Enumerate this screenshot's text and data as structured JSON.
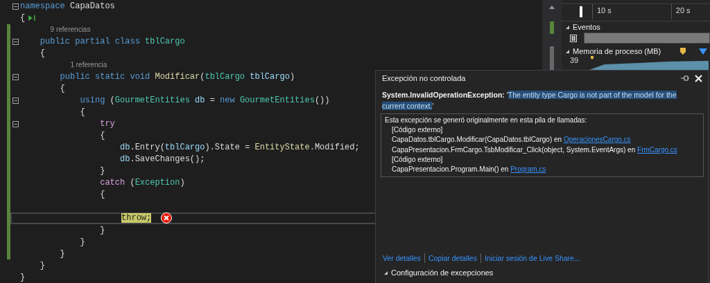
{
  "editor": {
    "lines": [
      {
        "kind": "code",
        "foldable": true,
        "changed": false,
        "tokens": [
          {
            "text": "namespace",
            "kind": "keyword"
          },
          {
            "text": " CapaDatos",
            "kind": "plain"
          }
        ]
      },
      {
        "kind": "code",
        "foldable": false,
        "changed": false,
        "run_marker": true,
        "tokens": [
          {
            "text": "{",
            "kind": "plain"
          }
        ]
      },
      {
        "kind": "lens",
        "changed": true,
        "text": "        9 referencias"
      },
      {
        "kind": "code",
        "foldable": true,
        "changed": true,
        "tokens": [
          {
            "text": "    public partial class",
            "kind": "keyword"
          },
          {
            "text": " tblCargo",
            "kind": "type"
          }
        ]
      },
      {
        "kind": "code",
        "foldable": false,
        "changed": true,
        "tokens": [
          {
            "text": "    {",
            "kind": "plain"
          }
        ]
      },
      {
        "kind": "lens",
        "changed": true,
        "text": "            1 referencia"
      },
      {
        "kind": "code",
        "foldable": true,
        "changed": true,
        "tokens": [
          {
            "text": "        public static void",
            "kind": "keyword"
          },
          {
            "text": " Modificar",
            "kind": "method"
          },
          {
            "text": "(",
            "kind": "plain"
          },
          {
            "text": "tblCargo",
            "kind": "type"
          },
          {
            "text": " tblCargo",
            "kind": "variable"
          },
          {
            "text": ")",
            "kind": "plain"
          }
        ]
      },
      {
        "kind": "code",
        "foldable": false,
        "changed": true,
        "tokens": [
          {
            "text": "        {",
            "kind": "plain"
          }
        ]
      },
      {
        "kind": "code",
        "foldable": true,
        "changed": true,
        "tokens": [
          {
            "text": "            using",
            "kind": "keyword"
          },
          {
            "text": " (",
            "kind": "plain"
          },
          {
            "text": "GourmetEntities",
            "kind": "type"
          },
          {
            "text": " db",
            "kind": "variable"
          },
          {
            "text": " = ",
            "kind": "plain"
          },
          {
            "text": "new",
            "kind": "keyword"
          },
          {
            "text": " GourmetEntities",
            "kind": "type"
          },
          {
            "text": "())",
            "kind": "plain"
          }
        ]
      },
      {
        "kind": "code",
        "foldable": false,
        "changed": true,
        "tokens": [
          {
            "text": "            {",
            "kind": "plain"
          }
        ]
      },
      {
        "kind": "code",
        "foldable": true,
        "changed": true,
        "tokens": [
          {
            "text": "                try",
            "kind": "control"
          }
        ]
      },
      {
        "kind": "code",
        "foldable": false,
        "changed": true,
        "tokens": [
          {
            "text": "                {",
            "kind": "plain"
          }
        ]
      },
      {
        "kind": "code",
        "foldable": false,
        "changed": true,
        "tokens": [
          {
            "text": "                    db",
            "kind": "variable"
          },
          {
            "text": ".Entry(",
            "kind": "plain"
          },
          {
            "text": "tblCargo",
            "kind": "variable"
          },
          {
            "text": ").State = ",
            "kind": "plain"
          },
          {
            "text": "EntityState",
            "kind": "method"
          },
          {
            "text": ".Modified;",
            "kind": "plain"
          }
        ]
      },
      {
        "kind": "code",
        "foldable": false,
        "changed": true,
        "tokens": [
          {
            "text": "                    db",
            "kind": "variable"
          },
          {
            "text": ".SaveChanges();",
            "kind": "plain"
          }
        ]
      },
      {
        "kind": "code",
        "foldable": false,
        "changed": true,
        "tokens": [
          {
            "text": "                }",
            "kind": "plain"
          }
        ]
      },
      {
        "kind": "code",
        "foldable": false,
        "changed": true,
        "tokens": [
          {
            "text": "                catch",
            "kind": "control"
          },
          {
            "text": " (",
            "kind": "plain"
          },
          {
            "text": "Exception",
            "kind": "type"
          },
          {
            "text": ")",
            "kind": "plain"
          }
        ]
      },
      {
        "kind": "code",
        "foldable": false,
        "changed": true,
        "tokens": [
          {
            "text": "                {",
            "kind": "plain"
          }
        ]
      },
      {
        "kind": "code",
        "changed": true
      },
      {
        "kind": "code",
        "foldable": false,
        "changed": true,
        "current": true,
        "error": true,
        "tokens": [
          {
            "text": "                    throw;",
            "kind": "highlight"
          }
        ]
      },
      {
        "kind": "code",
        "foldable": false,
        "changed": true,
        "tokens": [
          {
            "text": "                }",
            "kind": "plain"
          }
        ]
      },
      {
        "kind": "code",
        "foldable": false,
        "changed": true,
        "tokens": [
          {
            "text": "            }",
            "kind": "plain"
          }
        ]
      },
      {
        "kind": "code",
        "foldable": false,
        "changed": true,
        "tokens": [
          {
            "text": "        }",
            "kind": "plain"
          }
        ]
      },
      {
        "kind": "code",
        "foldable": false,
        "changed": false,
        "tokens": [
          {
            "text": "    }",
            "kind": "plain"
          }
        ]
      },
      {
        "kind": "code",
        "foldable": false,
        "changed": false,
        "tokens": [
          {
            "text": "}",
            "kind": "plain"
          }
        ]
      }
    ]
  },
  "diagnostics": {
    "timeline_labels": [
      "10 s",
      "20 s"
    ],
    "sections": [
      {
        "title": "Eventos",
        "expanded": true,
        "kind": "events"
      },
      {
        "title": "Memoria de proceso (MB)",
        "expanded": true,
        "kind": "memory",
        "axis_label": "39"
      }
    ]
  },
  "exception_popup": {
    "title": "Excepción no controlada",
    "exception_type": "System.InvalidOperationException:",
    "message": "'The entity type Cargo is not part of the model for the current context.'",
    "message_selected": true,
    "stack_heading": "Esta excepción se generó originalmente en esta pila de llamadas:",
    "stack": [
      {
        "text": "[Código externo]"
      },
      {
        "text": "CapaDatos.tblCargo.Modificar(CapaDatos.tblCargo) en ",
        "link": "OperacionesCargo.cs"
      },
      {
        "text": "CapaPresentacion.FrmCargo.TsbModificar_Click(object, System.EventArgs) en ",
        "link": "FrmCargo.cs"
      },
      {
        "text": "[Código externo]"
      },
      {
        "text": "CapaPresentacion.Program.Main() en ",
        "link": "Program.cs"
      }
    ],
    "links": [
      "Ver detalles",
      "Copiar detalles",
      "Iniciar sesión de Live Share..."
    ],
    "settings": {
      "title": "Configuración de excepciones",
      "expanded": true
    }
  }
}
